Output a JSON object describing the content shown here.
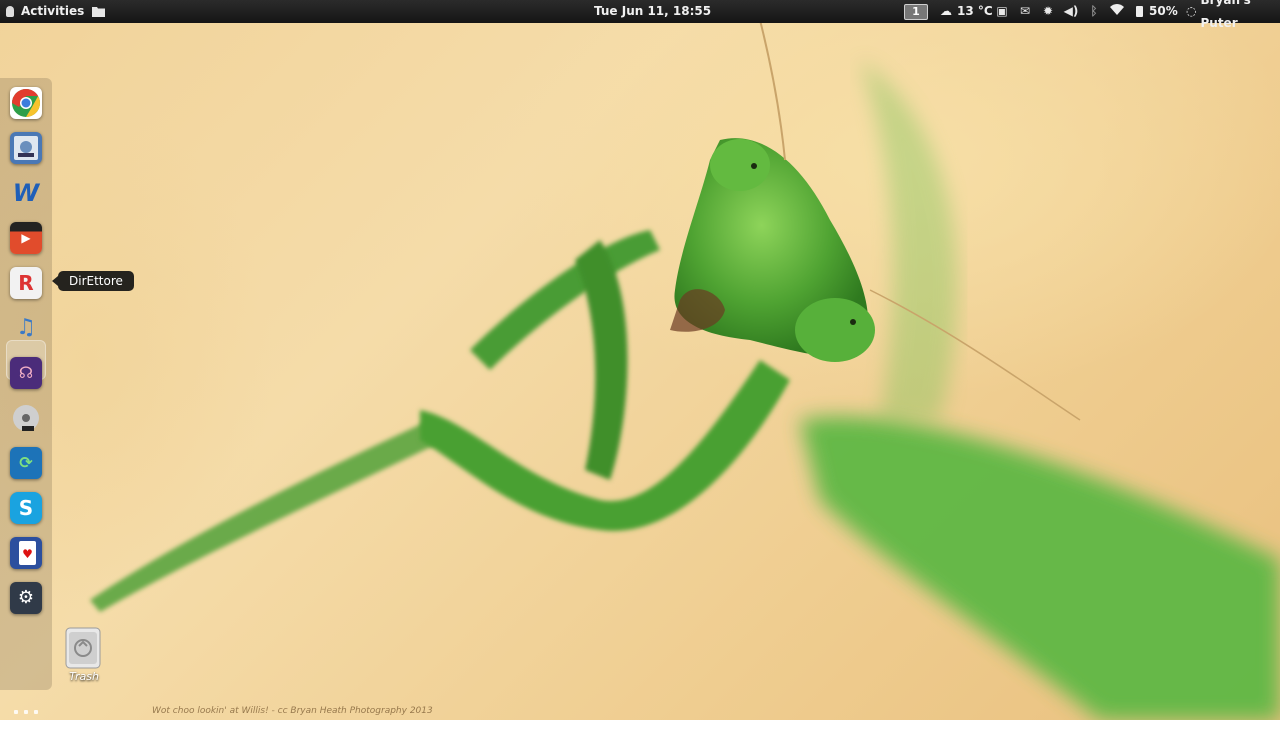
{
  "topbar": {
    "activities_label": "Activities",
    "clock": "Tue Jun 11, 18:55",
    "workspace_number": "1",
    "weather": "13 °C",
    "battery": "50%",
    "user_name": "Bryan's Puter",
    "tray_icons": [
      "screen-icon",
      "mail-icon",
      "brightness-icon",
      "volume-icon",
      "bluetooth-icon",
      "wifi-icon"
    ]
  },
  "dock": {
    "apps": [
      {
        "name": "chrome-app-icon",
        "color": "#dc3b2e"
      },
      {
        "name": "image-viewer-app-icon",
        "color": "#4a78b5"
      },
      {
        "name": "writer-app-icon",
        "color": "#1f5fb8"
      },
      {
        "name": "video-editor-app-icon",
        "color": "#d8432b"
      },
      {
        "name": "direttore-app-icon",
        "color": "#3a6fb0"
      },
      {
        "name": "music-player-app-icon",
        "color": "#5b8fc9"
      },
      {
        "name": "podcast-app-icon",
        "color": "#4b2c7a"
      },
      {
        "name": "disc-burner-app-icon",
        "color": "#b9b9b9"
      },
      {
        "name": "sync-app-icon",
        "color": "#1d73b8"
      },
      {
        "name": "skype-app-icon",
        "color": "#1aa3e0"
      },
      {
        "name": "cards-app-icon",
        "color": "#2c4f9e"
      },
      {
        "name": "settings-app-icon",
        "color": "#303a48"
      }
    ],
    "tooltip": "DirEttore"
  },
  "desktop": {
    "trash_label": "Trash",
    "wallpaper_credit": "Wot choo lookin' at Willis! - cc Bryan Heath Photography 2013"
  }
}
